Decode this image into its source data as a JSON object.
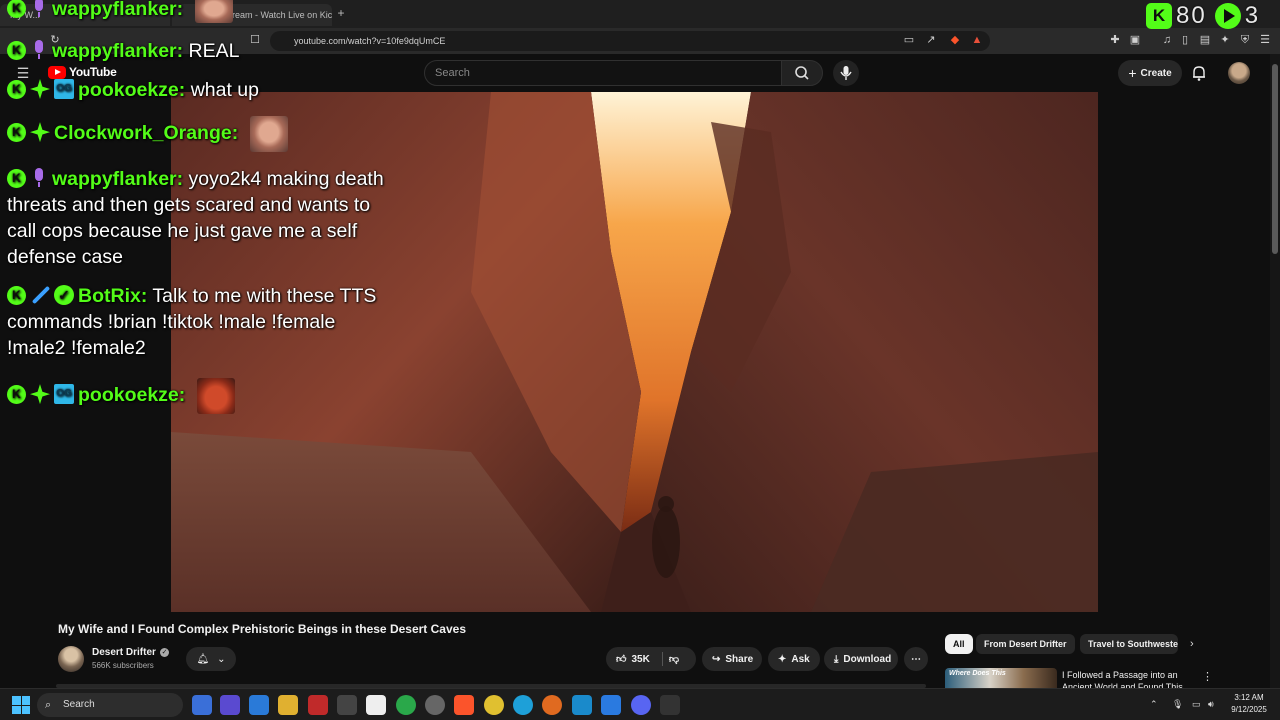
{
  "browser": {
    "tabs": [
      {
        "label": "My W..."
      },
      {
        "label": "ream - Watch Live on Kick"
      }
    ],
    "new_tab": "+",
    "url": "youtube.com/watch?v=10fe9dqUmCE"
  },
  "youtube": {
    "logo_text": "YouTube",
    "search_placeholder": "Search",
    "create_label": "Create"
  },
  "video": {
    "title": "My Wife and I Found Complex Prehistoric Beings in these Desert Caves",
    "channel": "Desert Drifter",
    "subscribers": "566K subscribers",
    "likes": "35K",
    "share_label": "Share",
    "ask_label": "Ask",
    "download_label": "Download"
  },
  "recommendations": {
    "chips": [
      "All",
      "From Desert Drifter",
      "Travel to Southwester"
    ],
    "first": {
      "thumb_text": "Where Does This",
      "title": "I Followed a Passage into an Ancient World and Found This"
    }
  },
  "chat": [
    {
      "user": "wappyflanker:",
      "message": ""
    },
    {
      "user": "wappyflanker:",
      "message": "REAL"
    },
    {
      "user": "pookoekze:",
      "message": "what up"
    },
    {
      "user": "Clockwork_Orange:",
      "message": ""
    },
    {
      "user": "wappyflanker:",
      "message_lines": [
        "yoyo2k4 making death",
        "threats and then gets scared and wants to",
        "call cops because he just gave me a self",
        "defense case"
      ]
    },
    {
      "user": "BotRix:",
      "message_lines": [
        "Talk to me with these TTS",
        "commands !brian !tiktok !male !female",
        "!male2 !female2"
      ]
    },
    {
      "user": "pookoekze:",
      "message": ""
    }
  ],
  "viewers": {
    "count": "80",
    "secondary": "3"
  },
  "taskbar": {
    "search_label": "Search",
    "time": "3:12 AM",
    "date": "9/12/2025"
  },
  "colors": {
    "kick_green": "#53fc18",
    "youtube_red": "#ff0000",
    "background": "#0f0f0f"
  }
}
